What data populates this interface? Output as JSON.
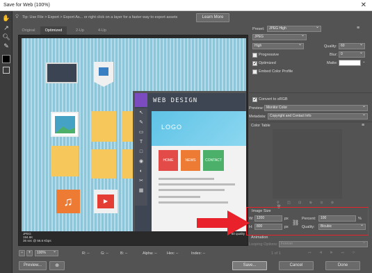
{
  "window": {
    "title": "Save for Web (100%)",
    "close": "✕"
  },
  "tip": "Tip: Use File > Export > Export As... or right click on a layer for a faster way to export assets",
  "learn_more": "Learn More",
  "tabs": [
    "Original",
    "Optimized",
    "2-Up",
    "4-Up"
  ],
  "image": {
    "title": "WEB DESIGN",
    "logo": "LOGO",
    "nav": [
      "HOME",
      "NEWS",
      "CONTACT"
    ]
  },
  "info": {
    "format": "JPEG",
    "size": "194.6K",
    "time": "36 sec @ 56.6 Kbps",
    "quality": "60 quality"
  },
  "status_bar": {
    "zoom": "100%",
    "r": "R: --",
    "g": "G: --",
    "b": "B: --",
    "alpha": "Alpha: --",
    "hex": "Hex: --",
    "index": "Index: --"
  },
  "panel": {
    "preset_label": "Preset:",
    "preset_value": "JPEG High",
    "format_value": "JPEG",
    "compression_value": "High",
    "quality_label": "Quality:",
    "quality_value": "60",
    "progressive_label": "Progressive",
    "blur_label": "Blur:",
    "blur_value": "0",
    "optimized_label": "Optimized",
    "matte_label": "Matte:",
    "embed_label": "Embed Color Profile",
    "convert_label": "Convert to sRGB",
    "preview_label": "Preview:",
    "preview_value": "Monitor Color",
    "metadata_label": "Metadata:",
    "metadata_value": "Copyright and Contact Info",
    "color_table_label": "Color Table",
    "image_size_label": "Image Size",
    "w_label": "W:",
    "w_value": "1200",
    "h_label": "H:",
    "h_value": "800",
    "px": "px",
    "percent_label": "Percent:",
    "percent_value": "100",
    "percent_unit": "%",
    "quality_resample_label": "Quality:",
    "quality_resample_value": "Bicubic",
    "animation_label": "Animation",
    "looping_label": "Looping Options:",
    "looping_value": "Forever",
    "frame_counter": "1 of 1"
  },
  "buttons": {
    "preview": "Preview...",
    "save": "Save...",
    "cancel": "Cancel",
    "done": "Done"
  },
  "colors": {
    "accent_red": "#e8212a",
    "canvas_bg": "#8ec6d9"
  }
}
